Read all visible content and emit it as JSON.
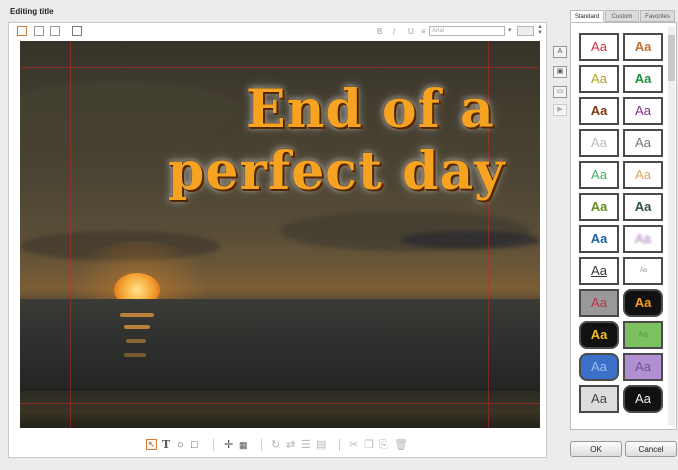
{
  "window": {
    "title": "Editing title"
  },
  "toolbar": {
    "format_buttons": [
      "B",
      "/",
      "U",
      "≡"
    ],
    "font_placeholder": "Arial"
  },
  "canvas": {
    "line1": "End of a",
    "line2": "perfect day"
  },
  "tabs": [
    {
      "label": "Standard",
      "active": true
    },
    {
      "label": "Custom",
      "active": false
    },
    {
      "label": "Favorites",
      "active": false
    }
  ],
  "styles": {
    "sample_text": "Aa"
  },
  "buttons": {
    "ok": "OK",
    "cancel": "Cancel"
  },
  "colors": {
    "accent": "#d07a3c",
    "title_text": "#f6a322"
  }
}
